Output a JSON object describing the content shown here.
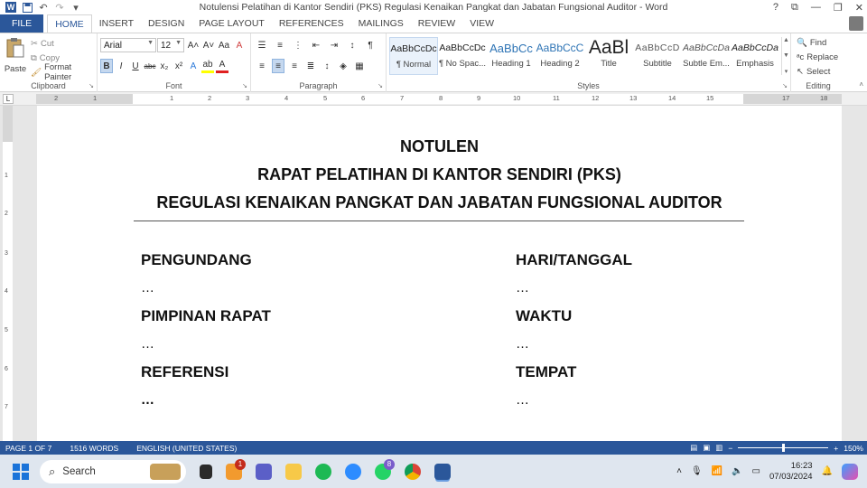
{
  "window": {
    "title": "Notulensi Pelatihan di Kantor Sendiri (PKS) Regulasi Kenaikan Pangkat dan Jabatan Fungsional Auditor - Word",
    "controls": [
      "?",
      "⧉",
      "—",
      "❐",
      "✕"
    ]
  },
  "quick_access": {
    "word_logo": "W",
    "save": "💾",
    "undo": "↶",
    "redo": "↷",
    "more": "▾"
  },
  "tabs": [
    "FILE",
    "HOME",
    "INSERT",
    "DESIGN",
    "PAGE LAYOUT",
    "REFERENCES",
    "MAILINGS",
    "REVIEW",
    "VIEW"
  ],
  "active_tab": "HOME",
  "ribbon": {
    "clipboard": {
      "label": "Clipboard",
      "paste": "Paste",
      "cut": "Cut",
      "copy": "Copy",
      "format_painter": "Format Painter"
    },
    "font": {
      "label": "Font",
      "name": "Arial",
      "size": "12",
      "grow": "A˄",
      "shrink": "A˅",
      "case": "Aa",
      "clear": "A",
      "bold": "B",
      "italic": "I",
      "underline": "U",
      "strike": "abc",
      "sub": "x₂",
      "sup": "x²",
      "effects": "A",
      "highlight": "ab",
      "color": "A"
    },
    "paragraph": {
      "label": "Paragraph"
    },
    "styles": {
      "label": "Styles",
      "items": [
        {
          "preview": "AaBbCcDc",
          "name": "¶ Normal"
        },
        {
          "preview": "AaBbCcDc",
          "name": "¶ No Spac..."
        },
        {
          "preview": "AaBbCc",
          "name": "Heading 1"
        },
        {
          "preview": "AaBbCcC",
          "name": "Heading 2"
        },
        {
          "preview": "AaBl",
          "name": "Title"
        },
        {
          "preview": "AaBbCcD",
          "name": "Subtitle"
        },
        {
          "preview": "AaBbCcDa",
          "name": "Subtle Em..."
        },
        {
          "preview": "AaBbCcDa",
          "name": "Emphasis"
        }
      ]
    },
    "editing": {
      "label": "Editing",
      "find": "Find",
      "replace": "Replace",
      "select": "Select"
    }
  },
  "ruler": {
    "numbers": [
      "2",
      "1",
      "1",
      "2",
      "3",
      "4",
      "5",
      "6",
      "7",
      "8",
      "9",
      "10",
      "11",
      "12",
      "13",
      "14",
      "15",
      "17",
      "18"
    ],
    "tab_selector": "L",
    "vertical_numbers": [
      "1",
      "2",
      "3",
      "4",
      "5",
      "6",
      "7"
    ]
  },
  "document": {
    "title1": "NOTULEN",
    "title2": "RAPAT PELATIHAN DI KANTOR SENDIRI (PKS)",
    "title3": "REGULASI KENAIKAN PANGKAT DAN JABATAN FUNGSIONAL AUDITOR",
    "left": [
      {
        "label": "PENGUNDANG",
        "value": "…"
      },
      {
        "label": "PIMPINAN RAPAT",
        "value": "…"
      },
      {
        "label": "REFERENSI",
        "value": "…"
      }
    ],
    "right": [
      {
        "label": "HARI/TANGGAL",
        "value": "…"
      },
      {
        "label": "WAKTU",
        "value": "…"
      },
      {
        "label": "TEMPAT",
        "value": "…"
      }
    ]
  },
  "statusbar": {
    "page": "PAGE 1 OF 7",
    "words": "1516 WORDS",
    "language": "ENGLISH (UNITED STATES)",
    "zoom": "150%",
    "zoom_level": 0.5
  },
  "taskbar": {
    "search": "Search",
    "notification_badge_1": "1",
    "notification_badge_2": "8",
    "time": "16:23",
    "date": "07/03/2024"
  }
}
